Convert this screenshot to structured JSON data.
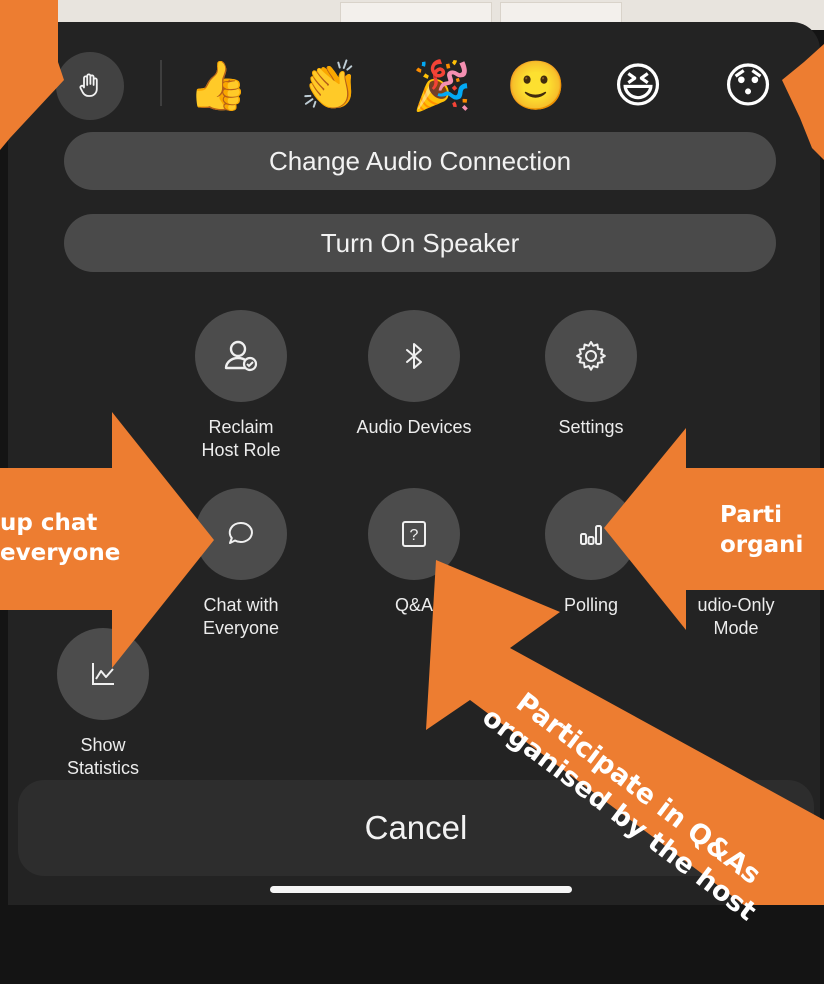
{
  "reactions": {
    "raise_hand_icon": "raised-hand-icon",
    "emojis": [
      {
        "name": "thumbs-up",
        "glyph": "👍"
      },
      {
        "name": "clap",
        "glyph": "👏"
      },
      {
        "name": "party",
        "glyph": "🎉"
      },
      {
        "name": "smile",
        "glyph": "🙂"
      },
      {
        "name": "laugh",
        "glyph": "😆"
      },
      {
        "name": "surprised",
        "glyph": "😯"
      }
    ]
  },
  "buttons": {
    "change_audio": "Change Audio Connection",
    "speaker": "Turn On Speaker",
    "cancel": "Cancel"
  },
  "grid": {
    "reclaim_host": "Reclaim\nHost Role",
    "audio_devices": "Audio Devices",
    "settings": "Settings",
    "chat_everyone": "Chat with\nEveryone",
    "qa": "Q&A",
    "polling": "Polling",
    "audio_only_partial": "udio-Only\nMode",
    "show_statistics": "Show\nStatistics"
  },
  "qa_icon_glyph": "?",
  "callouts": {
    "left": "up chat\neveryone",
    "right": "Parti\norgani",
    "bottom": "Participate in Q&As\norganised by the host"
  },
  "colors": {
    "accent_orange": "#ed7d31",
    "sheet_background": "#232323",
    "button_gray": "#4a4a4a"
  }
}
